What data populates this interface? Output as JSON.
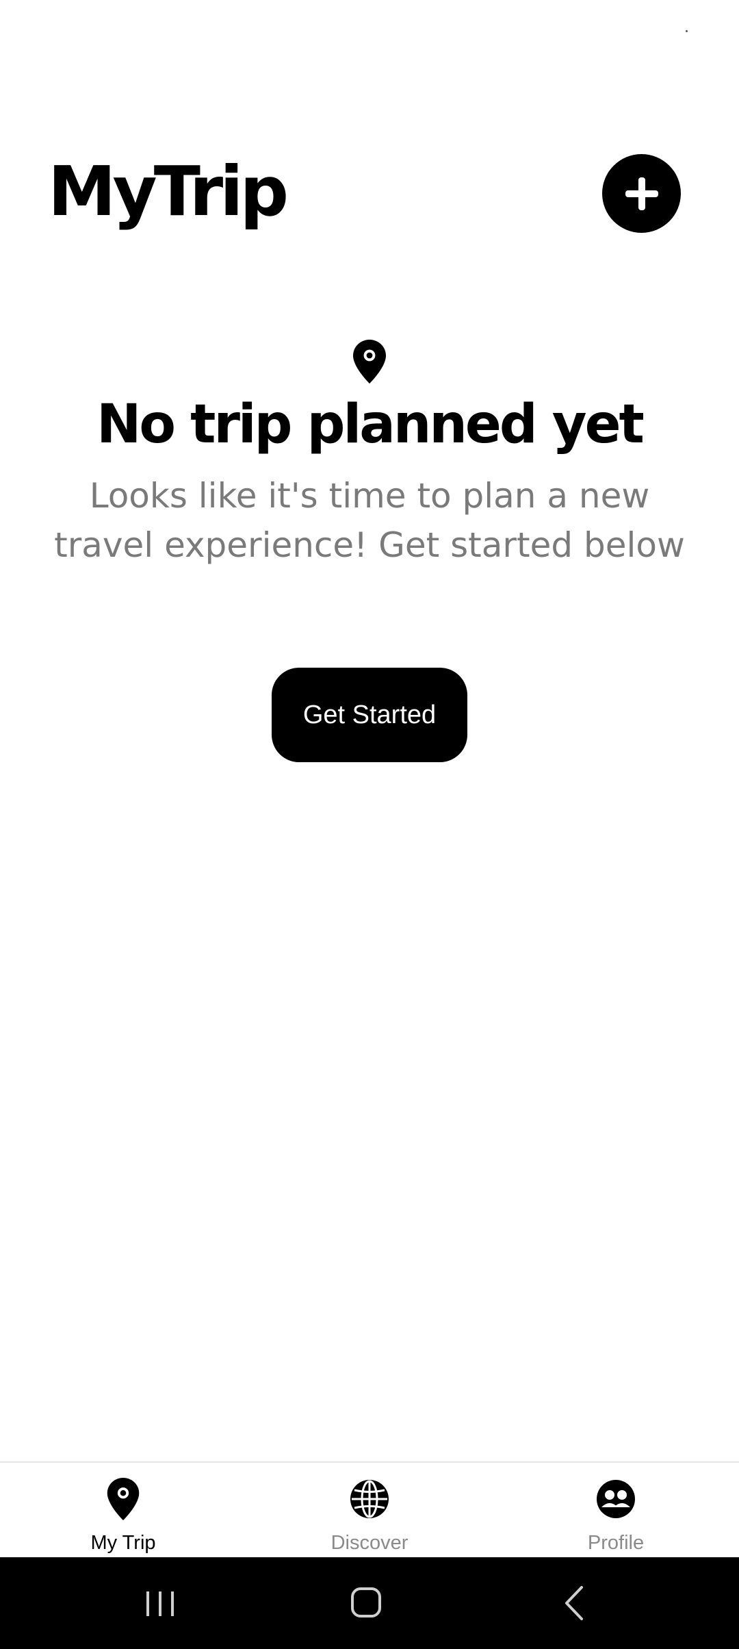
{
  "header": {
    "title": "MyTrip",
    "add_icon": "plus-icon"
  },
  "empty_state": {
    "icon": "map-pin-icon",
    "title": "No trip planned yet",
    "subtitle": "Looks like it's time to plan a new travel experience! Get started below",
    "button_label": "Get Started"
  },
  "bottom_nav": {
    "items": [
      {
        "label": "My Trip",
        "icon": "map-pin-icon",
        "active": true
      },
      {
        "label": "Discover",
        "icon": "globe-icon",
        "active": false
      },
      {
        "label": "Profile",
        "icon": "people-icon",
        "active": false
      }
    ]
  },
  "system_nav": {
    "recents_icon": "recents-icon",
    "home_icon": "home-icon",
    "back_icon": "back-icon"
  },
  "colors": {
    "primary": "#000000",
    "background": "#ffffff",
    "muted_text": "#7a7a7a",
    "inactive_nav": "#8a8a8a"
  }
}
